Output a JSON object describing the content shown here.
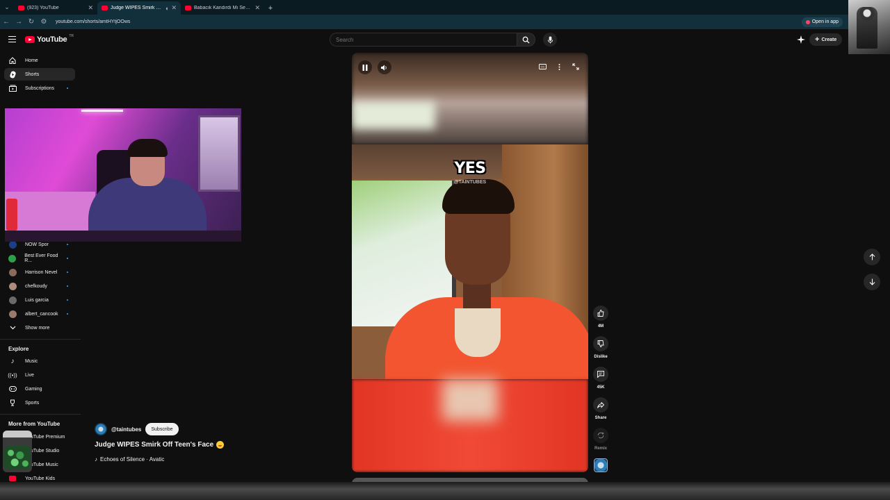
{
  "browser": {
    "tabs": [
      {
        "title": "(923) YouTube",
        "active": false
      },
      {
        "title": "Judge WIPES Smirk Off Tee",
        "active": true
      },
      {
        "title": "Babacık Kandırdı Mı Seni? - Yo",
        "active": false
      }
    ],
    "url": "youtube.com/shorts/amtHYtjOOws",
    "open_in_app": "Open in app"
  },
  "masthead": {
    "logo_text": "YouTube",
    "logo_country": "TR",
    "search_placeholder": "Search",
    "create_label": "Create"
  },
  "sidebar": {
    "main": [
      {
        "label": "Home",
        "icon": "home-icon"
      },
      {
        "label": "Shorts",
        "icon": "shorts-icon",
        "active": true
      },
      {
        "label": "Subscriptions",
        "icon": "subscriptions-icon"
      }
    ],
    "subscriptions": [
      {
        "label": "NOW Spor",
        "avatar_color": "#1a3f8a"
      },
      {
        "label": "Best Ever Food R...",
        "avatar_color": "#2fa04a"
      },
      {
        "label": "Harrison Nevel",
        "avatar_color": "#8a6a5a"
      },
      {
        "label": "chefkoudy",
        "avatar_color": "#b08a7a"
      },
      {
        "label": "Luis garcia",
        "avatar_color": "#6a6a6a"
      },
      {
        "label": "albert_cancook",
        "avatar_color": "#9a7a6a"
      }
    ],
    "show_more": "Show more",
    "explore_title": "Explore",
    "explore": [
      {
        "label": "Music",
        "icon": "music-note-icon"
      },
      {
        "label": "Live",
        "icon": "live-icon"
      },
      {
        "label": "Gaming",
        "icon": "gaming-icon"
      },
      {
        "label": "Sports",
        "icon": "trophy-icon"
      }
    ],
    "more_title": "More from YouTube",
    "more": [
      {
        "label": "YouTube Premium"
      },
      {
        "label": "YouTube Studio"
      },
      {
        "label": "YouTube Music"
      },
      {
        "label": "YouTube Kids"
      }
    ]
  },
  "short": {
    "caption": "YES",
    "watermark": "@TAINTUBES",
    "channel": "@taintubes",
    "subscribe": "Subscribe",
    "title": "Judge WIPES Smirk Off Teen's Face",
    "music": "Echoes of Silence · Avatic"
  },
  "actions": {
    "like": "4M",
    "dislike": "Dislike",
    "comments": "45K",
    "share": "Share",
    "remix": "Remix"
  },
  "colors": {
    "brand_red": "#ff0033",
    "background": "#0f0f0f",
    "shirt_orange": "#f2552f"
  }
}
